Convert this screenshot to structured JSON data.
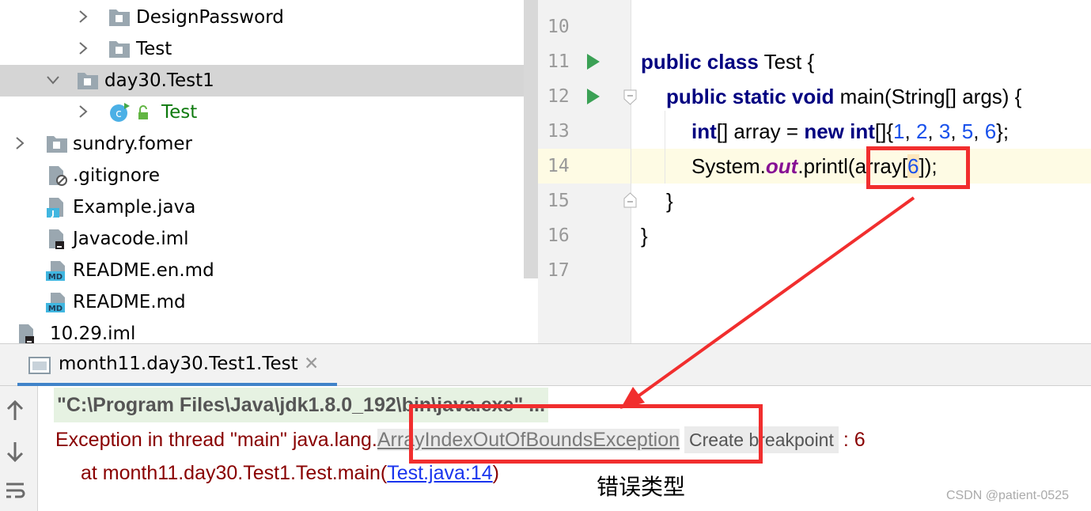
{
  "project_tree": {
    "items": [
      {
        "label": "DesignPassword",
        "kind": "package",
        "expanded": false,
        "selected": false
      },
      {
        "label": "Test",
        "kind": "package",
        "expanded": false,
        "selected": false
      },
      {
        "label": "day30.Test1",
        "kind": "package",
        "expanded": true,
        "selected": true
      },
      {
        "label": "Test",
        "kind": "class",
        "expanded": false,
        "selected": false
      },
      {
        "label": "sundry.fomer",
        "kind": "package",
        "expanded": false,
        "selected": false
      },
      {
        "label": ".gitignore",
        "kind": "ignore-file"
      },
      {
        "label": "Example.java",
        "kind": "java-file"
      },
      {
        "label": "Javacode.iml",
        "kind": "iml-file"
      },
      {
        "label": "README.en.md",
        "kind": "markdown-file"
      },
      {
        "label": "README.md",
        "kind": "markdown-file"
      },
      {
        "label": "10.29.iml",
        "kind": "iml-file"
      }
    ],
    "icon_badges": {
      "java": "J",
      "markdown": "MD",
      "class": "c"
    }
  },
  "editor": {
    "line_numbers": [
      "10",
      "11",
      "12",
      "13",
      "14",
      "15",
      "16",
      "17"
    ],
    "current_line": "14",
    "code": {
      "l11": {
        "kw": "public class",
        "rest": " Test {"
      },
      "l12": {
        "kw": "public static void",
        "rest": " main(String[] args) {"
      },
      "l13": {
        "kw1": "int",
        "t1": "[] array = ",
        "kw2": "new int",
        "t2": "[]{",
        "n1": "1",
        "c1": ", ",
        "n2": "2",
        "c2": ", ",
        "n3": "3",
        "c3": ", ",
        "n4": "5",
        "c4": ", ",
        "n5": "6",
        "t3": "};"
      },
      "l14": {
        "t1": "System.",
        "fld": "out",
        "t2": ".printl",
        "t3": "(array[",
        "n1": "6",
        "t4": "]",
        "t5": ")",
        "t6": ";"
      },
      "l15": "}",
      "l16": "}"
    }
  },
  "run_panel": {
    "tab_label": "month11.day30.Test1.Test",
    "close_glyph": "✕",
    "console": {
      "cmd": "\"C:\\Program Files\\Java\\jdk1.8.0_192\\bin\\java.exe\" ...",
      "exc_prefix": "Exception in thread \"main\" java.lang.",
      "exc_class": "ArrayIndexOutOfBoundsException",
      "breakpoint_chip": "Create breakpoint",
      "exc_suffix": ": 6",
      "at_prefix": "at month11.day30.Test1.Test.main(",
      "at_link": "Test.java:14",
      "at_suffix": ")"
    },
    "tools": [
      "arrow-up-icon",
      "arrow-down-icon",
      "soft-wrap-icon"
    ]
  },
  "annotation": {
    "label": "错误类型",
    "color": "#f12e2e"
  },
  "watermark": "CSDN @patient-0525"
}
